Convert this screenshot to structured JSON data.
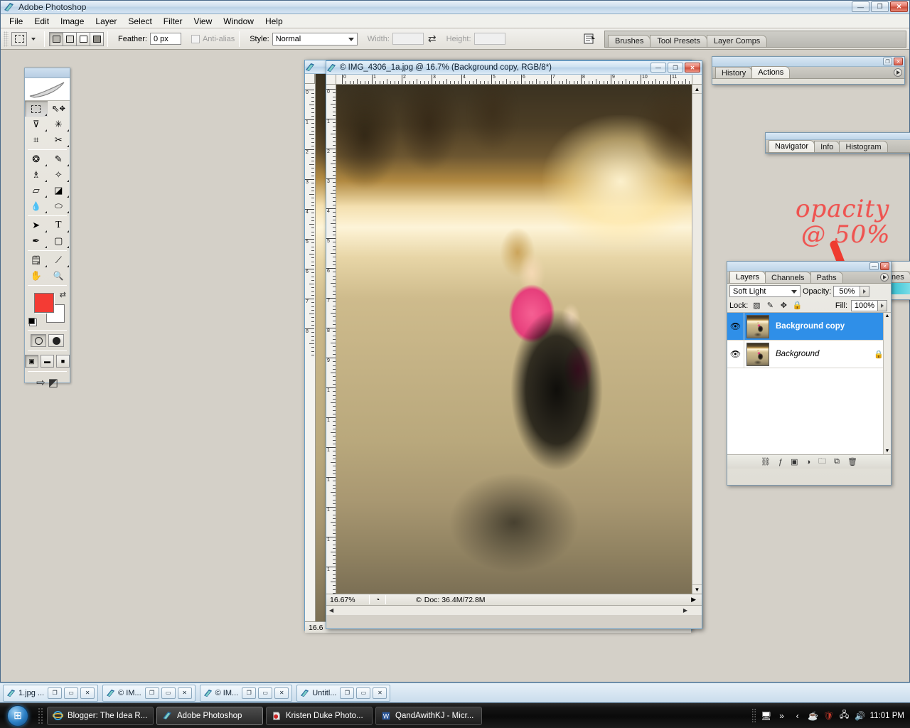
{
  "app": {
    "title": "Adobe Photoshop",
    "icon": "photoshop-icon",
    "window_buttons": {
      "minimize": "—",
      "restore": "❐",
      "close": "✕"
    }
  },
  "menubar": {
    "items": [
      "File",
      "Edit",
      "Image",
      "Layer",
      "Select",
      "Filter",
      "View",
      "Window",
      "Help"
    ]
  },
  "options_bar": {
    "tool_icon": "rectangular-marquee-icon",
    "selection_modes": [
      "new-selection",
      "add-to-selection",
      "subtract-from-selection",
      "intersect-selection"
    ],
    "feather_label": "Feather:",
    "feather_value": "0 px",
    "antialias_label": "Anti-alias",
    "style_label": "Style:",
    "style_value": "Normal",
    "width_label": "Width:",
    "width_value": "",
    "height_label": "Height:",
    "height_value": "",
    "swap_icon": "swap-dimensions-icon",
    "dock_icon": "dock-to-palette-well-icon",
    "palette_well_tabs": [
      "Brushes",
      "Tool Presets",
      "Layer Comps"
    ]
  },
  "toolbox": {
    "logo": "feather-logo",
    "tools": [
      {
        "name": "rectangular-marquee-tool",
        "glyph": "▭",
        "selected": true
      },
      {
        "name": "move-tool",
        "glyph": "✥"
      },
      {
        "name": "lasso-tool",
        "glyph": "✒"
      },
      {
        "name": "magic-wand-tool",
        "glyph": "✳"
      },
      {
        "name": "crop-tool",
        "glyph": "⌗"
      },
      {
        "name": "slice-tool",
        "glyph": "✂"
      },
      {
        "name": "healing-brush-tool",
        "glyph": "◌"
      },
      {
        "name": "brush-tool",
        "glyph": "✎"
      },
      {
        "name": "clone-stamp-tool",
        "glyph": "♗"
      },
      {
        "name": "history-brush-tool",
        "glyph": "✦"
      },
      {
        "name": "eraser-tool",
        "glyph": "▱"
      },
      {
        "name": "gradient-tool",
        "glyph": "◪"
      },
      {
        "name": "blur-tool",
        "glyph": "💧"
      },
      {
        "name": "dodge-tool",
        "glyph": "⬭"
      },
      {
        "name": "path-selection-tool",
        "glyph": "➤"
      },
      {
        "name": "type-tool",
        "glyph": "T"
      },
      {
        "name": "pen-tool",
        "glyph": "✑"
      },
      {
        "name": "rectangle-shape-tool",
        "glyph": "▢"
      },
      {
        "name": "notes-tool",
        "glyph": "🗒"
      },
      {
        "name": "eyedropper-tool",
        "glyph": "⟋"
      },
      {
        "name": "hand-tool",
        "glyph": "✋"
      },
      {
        "name": "zoom-tool",
        "glyph": "🔍"
      }
    ],
    "foreground_color": "#f43b34",
    "background_color": "#ffffff",
    "swap_colors_icon": "swap-colors-icon",
    "default_colors_icon": "default-colors-icon",
    "quick_mask_modes": [
      "standard-mode",
      "quick-mask-mode"
    ],
    "screen_modes": [
      "standard-screen-mode",
      "full-screen-with-menu-bar",
      "full-screen-mode"
    ],
    "jump_to_imageready_icon": "jump-to-imageready-icon"
  },
  "documents": [
    {
      "title": "© IMG_4306_1a.jpg @ 16.7% (Background copy, RGB/8*)",
      "zoom": "16.67%",
      "doc_size": "Doc: 36.4M/72.8M",
      "doc_prefix": "©",
      "ruler_units_h": [
        "0",
        "1",
        "2",
        "3",
        "4",
        "5",
        "6",
        "7",
        "8",
        "9",
        "10",
        "11",
        "1"
      ],
      "ruler_units_v": [
        "0",
        "1",
        "2",
        "3",
        "4",
        "5",
        "6",
        "7",
        "8",
        "9",
        "1",
        "1",
        "1",
        "1",
        "1",
        "1",
        "1",
        "1",
        "1"
      ],
      "buttons": {
        "minimize": "—",
        "maximize": "❐",
        "close": "✕"
      }
    },
    {
      "title": "",
      "zoom": "16.6",
      "doc_size": "",
      "ruler_units_v": [
        "0",
        "1",
        "2",
        "3",
        "4",
        "5",
        "6",
        "7",
        "8"
      ]
    }
  ],
  "panels": {
    "history_actions": {
      "tabs": [
        {
          "label": "History",
          "active": false
        },
        {
          "label": "Actions",
          "active": true
        }
      ],
      "buttons": {
        "minimize": "❐",
        "close": "✕"
      },
      "menu_icon": "panel-menu-icon"
    },
    "navigator": {
      "tabs": [
        {
          "label": "Navigator",
          "active": true
        },
        {
          "label": "Info",
          "active": false
        },
        {
          "label": "Histogram",
          "active": false
        }
      ]
    },
    "layers": {
      "buttons": {
        "minimize": "—",
        "close": "✕"
      },
      "tabs": [
        {
          "label": "Layers",
          "active": true
        },
        {
          "label": "Channels",
          "active": false
        },
        {
          "label": "Paths",
          "active": false
        }
      ],
      "menu_icon": "panel-menu-icon",
      "blend_mode": "Soft Light",
      "opacity_label": "Opacity:",
      "opacity_value": "50%",
      "lock_label": "Lock:",
      "lock_icons": [
        "lock-transparent-pixels-icon",
        "lock-image-pixels-icon",
        "lock-position-icon",
        "lock-all-icon"
      ],
      "fill_label": "Fill:",
      "fill_value": "100%",
      "rows": [
        {
          "name": "Background copy",
          "selected": true,
          "visible": true,
          "locked": false,
          "thumbnail": "layer-thumbnail"
        },
        {
          "name": "Background",
          "selected": false,
          "visible": true,
          "locked": true,
          "thumbnail": "layer-thumbnail"
        }
      ],
      "bottom_icons": [
        "link-layers-icon",
        "layer-style-icon",
        "layer-mask-icon",
        "new-adjustment-layer-icon",
        "new-group-icon",
        "new-layer-icon",
        "delete-layer-icon"
      ]
    },
    "hidden_right": {
      "tab_label": "nes"
    }
  },
  "annotation": {
    "line1": "opacity",
    "line2": "@ 50%",
    "color": "#ef5350",
    "arrow": "arrow-pointing-to-opacity-field"
  },
  "doc_tabs": [
    {
      "label": "1.jpg ...",
      "icon": "photoshop-doc-icon"
    },
    {
      "label": "© IM...",
      "icon": "photoshop-doc-icon"
    },
    {
      "label": "© IM...",
      "icon": "photoshop-doc-icon"
    },
    {
      "label": "Untitl...",
      "icon": "photoshop-doc-icon"
    }
  ],
  "doc_tab_buttons": {
    "restore": "❐",
    "minimize": "▭",
    "close": "✕"
  },
  "taskbar": {
    "start_icon": "windows-start-orb",
    "tasks": [
      {
        "label": "Blogger: The Idea R...",
        "icon": "internet-explorer-icon",
        "active": false
      },
      {
        "label": "Adobe Photoshop",
        "icon": "photoshop-icon",
        "active": true
      },
      {
        "label": "Kristen Duke Photo...",
        "icon": "acrobat-icon",
        "active": false
      },
      {
        "label": "QandAwithKJ - Micr...",
        "icon": "word-icon",
        "active": false
      }
    ],
    "tray_icons": [
      "show-desktop-icon",
      "show-hidden-icons-icon",
      "chevron-left-icon",
      "java-icon",
      "antivirus-icon",
      "network-icon",
      "volume-icon"
    ],
    "clock": "11:01 PM"
  }
}
